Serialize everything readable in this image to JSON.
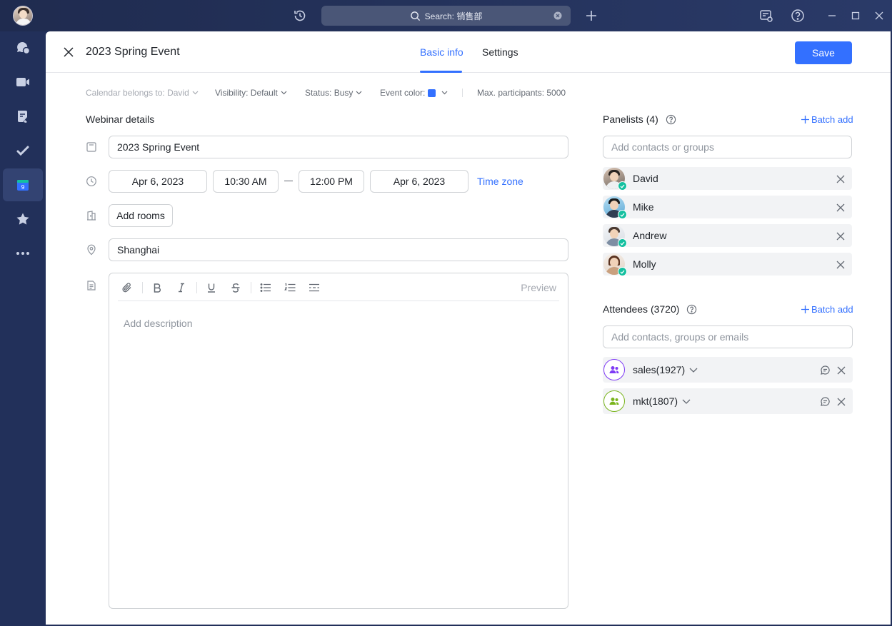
{
  "topbar": {
    "search_text": "Search: 销售部"
  },
  "header": {
    "title": "2023 Spring Event",
    "tabs": [
      {
        "label": "Basic info",
        "active": true
      },
      {
        "label": "Settings",
        "active": false
      }
    ],
    "save_label": "Save"
  },
  "meta": {
    "calendar": "Calendar belongs to: David",
    "visibility": "Visibility: Default",
    "status": "Status: Busy",
    "event_color_label": "Event color:",
    "event_color": "#3370ff",
    "max_participants": "Max. participants: 5000"
  },
  "details": {
    "section_label": "Webinar details",
    "title_value": "2023 Spring Event",
    "start_date": "Apr 6, 2023",
    "start_time": "10:30 AM",
    "end_time": "12:00 PM",
    "end_date": "Apr 6, 2023",
    "time_zone": "Time zone",
    "add_rooms": "Add rooms",
    "location": "Shanghai"
  },
  "editor": {
    "preview": "Preview",
    "placeholder": "Add description"
  },
  "panelists": {
    "label": "Panelists (4)",
    "batch_add": "Batch add",
    "placeholder": "Add contacts or groups",
    "people": [
      {
        "name": "David"
      },
      {
        "name": "Mike"
      },
      {
        "name": "Andrew"
      },
      {
        "name": "Molly"
      }
    ]
  },
  "attendees": {
    "label": "Attendees (3720)",
    "batch_add": "Batch add",
    "placeholder": "Add contacts, groups or emails",
    "groups": [
      {
        "name": "sales(1927)",
        "color": "#7f3bf5"
      },
      {
        "name": "mkt(1807)",
        "color": "#7ab51d"
      }
    ]
  }
}
